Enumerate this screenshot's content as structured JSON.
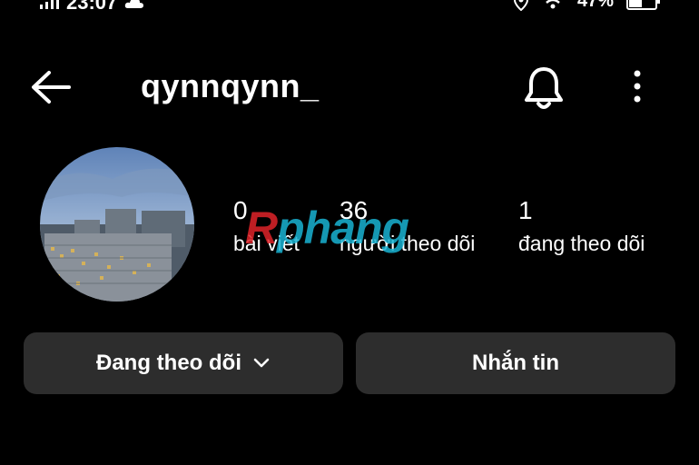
{
  "status_bar": {
    "time": "23:07",
    "battery": "47%",
    "battery_level": 0.47
  },
  "header": {
    "username": "qynnqynn_"
  },
  "stats": [
    {
      "value": "0",
      "label": "bài viết"
    },
    {
      "value": "36",
      "label": "người theo dõi"
    },
    {
      "value": "1",
      "label": "đang theo dõi"
    }
  ],
  "watermark": {
    "prefix": "R",
    "rest": "phang"
  },
  "actions": {
    "following_label": "Đang theo dõi",
    "message_label": "Nhắn tin"
  },
  "colors": {
    "background": "#000000",
    "button_bg": "#2d2d2d",
    "watermark_blue": "#19b3d3",
    "watermark_red": "#e0242a"
  }
}
